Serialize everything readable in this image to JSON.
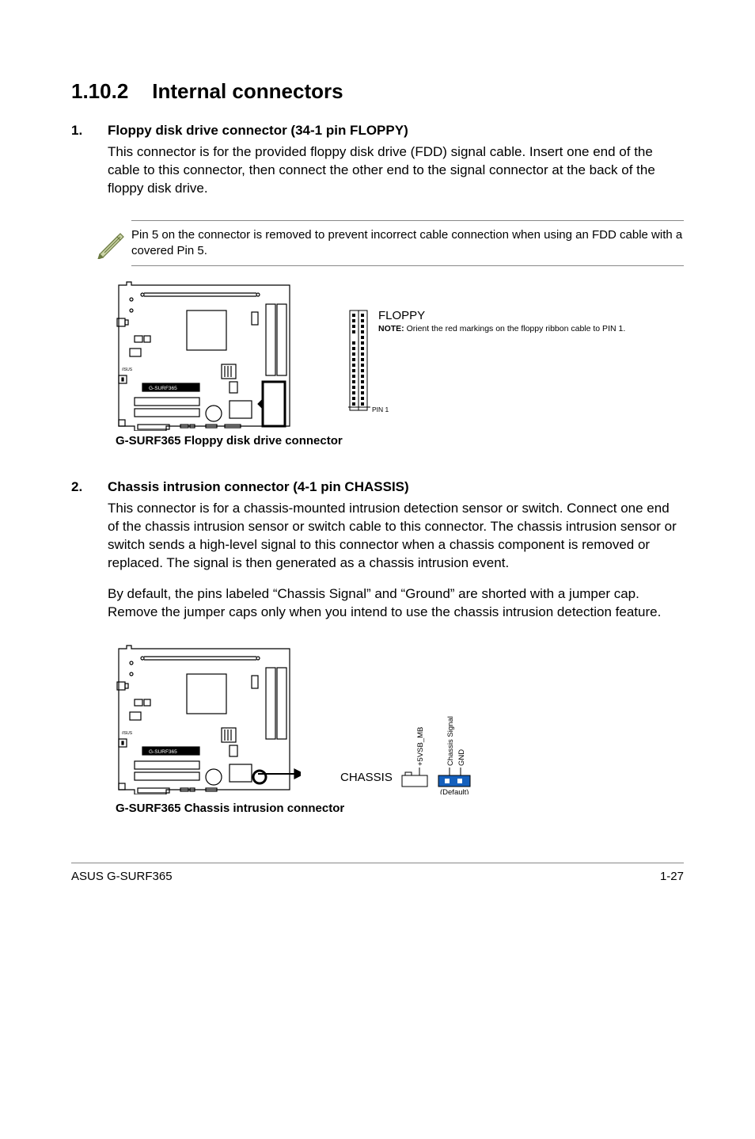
{
  "section": {
    "number": "1.10.2",
    "title": "Internal connectors"
  },
  "items": [
    {
      "num": "1.",
      "title": "Floppy disk drive connector (34-1 pin FLOPPY)",
      "body": "This connector is for the provided floppy disk drive (FDD) signal cable. Insert one end of the cable to this connector, then connect the other end to the signal connector at the back of the floppy disk drive."
    },
    {
      "num": "2.",
      "title": "Chassis intrusion connector (4-1 pin CHASSIS)",
      "body1": "This connector is for a chassis-mounted intrusion detection sensor or switch. Connect one end of the chassis intrusion sensor or switch cable to this connector. The chassis intrusion sensor or switch sends a high-level signal to this connector when a chassis component is removed or replaced. The signal is then generated as a chassis intrusion event.",
      "body2": "By default, the pins labeled “Chassis Signal” and “Ground” are shorted with a jumper cap. Remove the jumper caps only when you intend to use the chassis intrusion detection feature."
    }
  ],
  "note": "Pin 5 on the connector is removed to prevent incorrect cable connection when using an FDD cable with a covered Pin 5.",
  "diagram1": {
    "board_model": "G-SURF365",
    "conn_label": "FLOPPY",
    "note_bold": "NOTE:",
    "note_text": " Orient the red markings on the floppy ribbon cable to PIN 1.",
    "pin_label": "PIN 1",
    "caption": "G-SURF365 Floppy disk drive connector"
  },
  "diagram2": {
    "board_model": "G-SURF365",
    "chassis_label": "CHASSIS",
    "pin_labels": [
      "+5VSB_MB",
      "Chassis Signal",
      "GND"
    ],
    "default_label": "(Default)",
    "caption": "G-SURF365 Chassis intrusion connector"
  },
  "footer": {
    "left": "ASUS G-SURF365",
    "right": "1-27"
  }
}
